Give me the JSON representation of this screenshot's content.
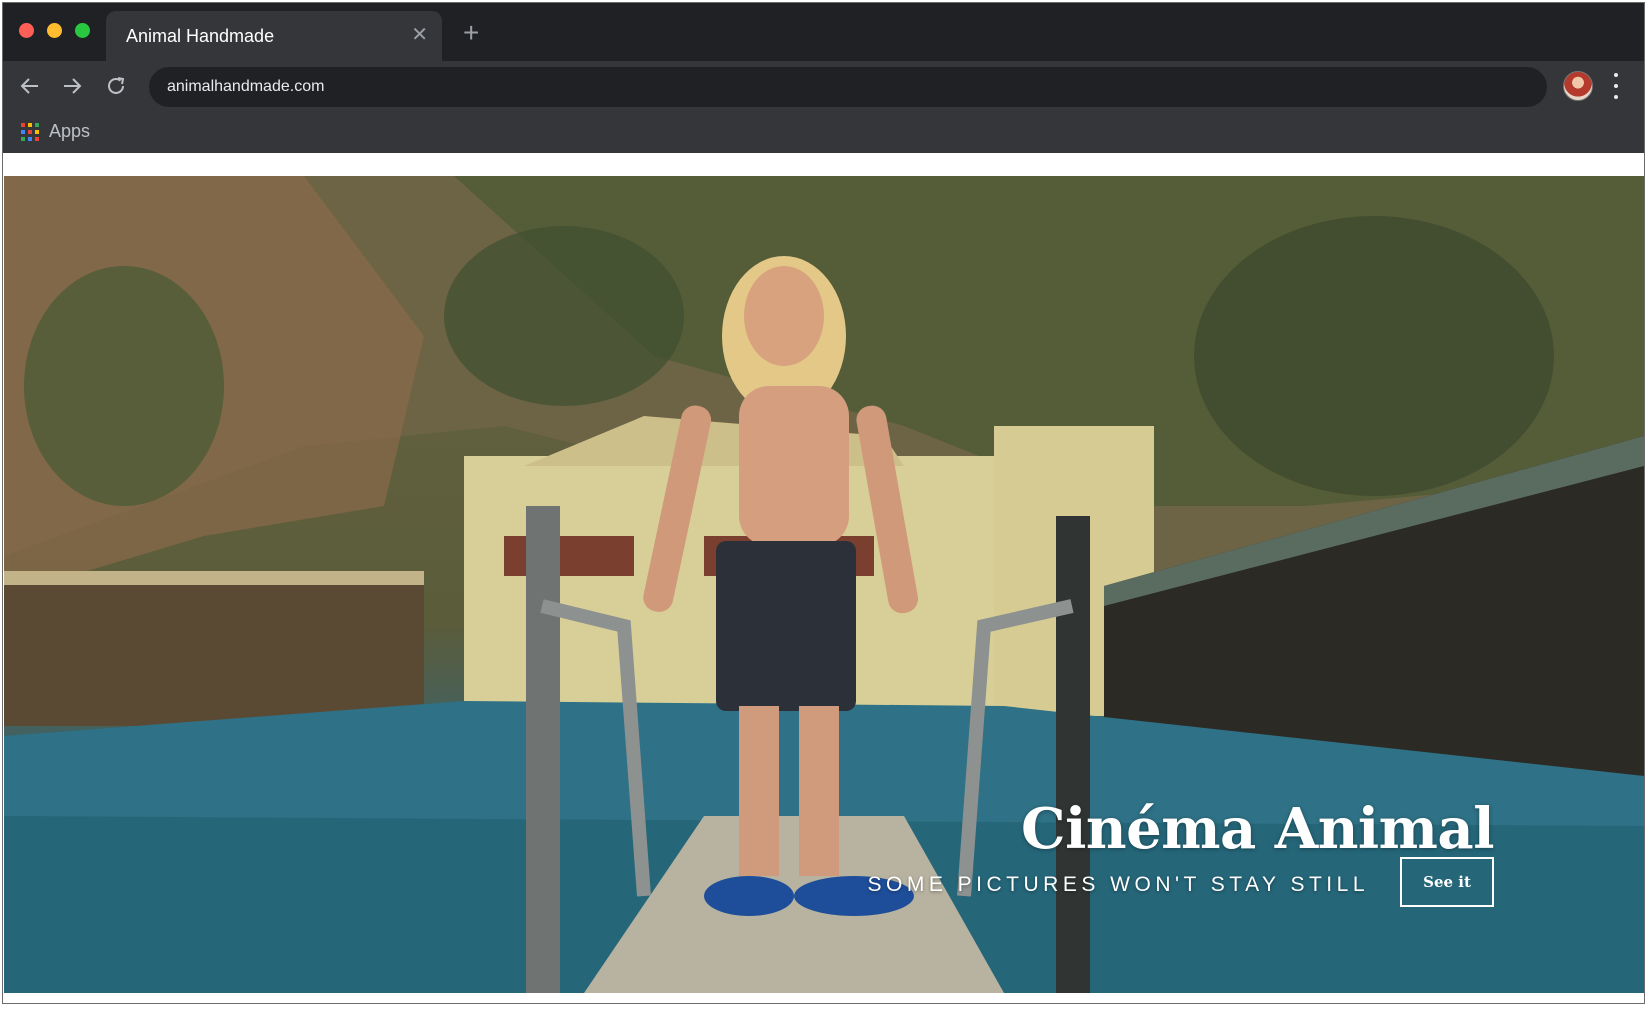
{
  "browser": {
    "tab_title": "Animal Handmade",
    "url": "animalhandmade.com",
    "bookmarks": [
      {
        "label": "Apps"
      }
    ],
    "icons": {
      "back": "back-arrow-icon",
      "forward": "forward-arrow-icon",
      "reload": "reload-icon",
      "menu": "kebab-menu-icon",
      "close_tab": "close-icon",
      "new_tab": "plus-icon"
    }
  },
  "hero": {
    "title": "Cinéma Animal",
    "tagline": "SOME PICTURES WON'T STAY STILL",
    "cta_label": "See it"
  }
}
